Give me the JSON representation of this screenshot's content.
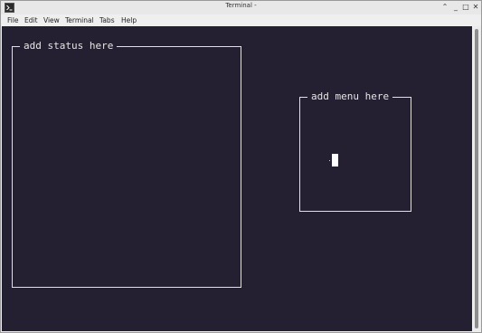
{
  "window": {
    "title": "Terminal -",
    "controls": {
      "collapse": "⌃",
      "minimize": "_",
      "maximize": "□",
      "close": "✕"
    }
  },
  "menu": [
    "File",
    "Edit",
    "View",
    "Terminal",
    "Tabs",
    "Help"
  ],
  "terminal": {
    "status_box_title": "add status here",
    "menu_box_title": "add menu here",
    "colors": {
      "background": "#241f31",
      "foreground": "#e6e6e6"
    }
  },
  "icons": {
    "app": "terminal-app-icon"
  }
}
